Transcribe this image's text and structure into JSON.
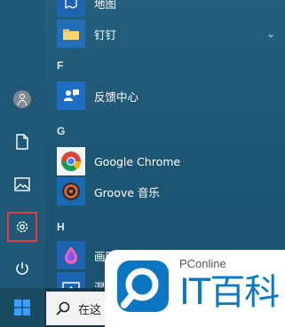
{
  "start_menu": {
    "sections": [
      {
        "letter": "",
        "apps": [
          {
            "label": "地图",
            "icon": "map-icon"
          },
          {
            "label": "钉钉",
            "icon": "folder-icon",
            "expandable": true
          }
        ]
      },
      {
        "letter": "F",
        "apps": [
          {
            "label": "反馈中心",
            "icon": "feedback-hub-icon"
          }
        ]
      },
      {
        "letter": "G",
        "apps": [
          {
            "label": "Google Chrome",
            "icon": "chrome-icon"
          },
          {
            "label": "Groove 音乐",
            "icon": "groove-music-icon"
          }
        ]
      },
      {
        "letter": "H",
        "apps": [
          {
            "label": "画图 3D",
            "icon": "paint-3d-icon"
          },
          {
            "label": "混",
            "icon": "mixed-reality-icon"
          }
        ]
      }
    ]
  },
  "left_rail": {
    "items": [
      {
        "name": "user-account",
        "icon": "user-icon"
      },
      {
        "name": "documents",
        "icon": "document-icon"
      },
      {
        "name": "pictures",
        "icon": "picture-icon"
      },
      {
        "name": "settings",
        "icon": "gear-icon",
        "highlighted": true
      },
      {
        "name": "power",
        "icon": "power-icon"
      }
    ]
  },
  "taskbar": {
    "start_icon": "windows-logo-icon",
    "search_icon": "search-icon",
    "search_text": "在这"
  },
  "watermark": {
    "site": "PConline",
    "brand": "IT百科"
  },
  "colors": {
    "highlight": "#e23b3b",
    "brand_blue": "#0b77c2"
  }
}
